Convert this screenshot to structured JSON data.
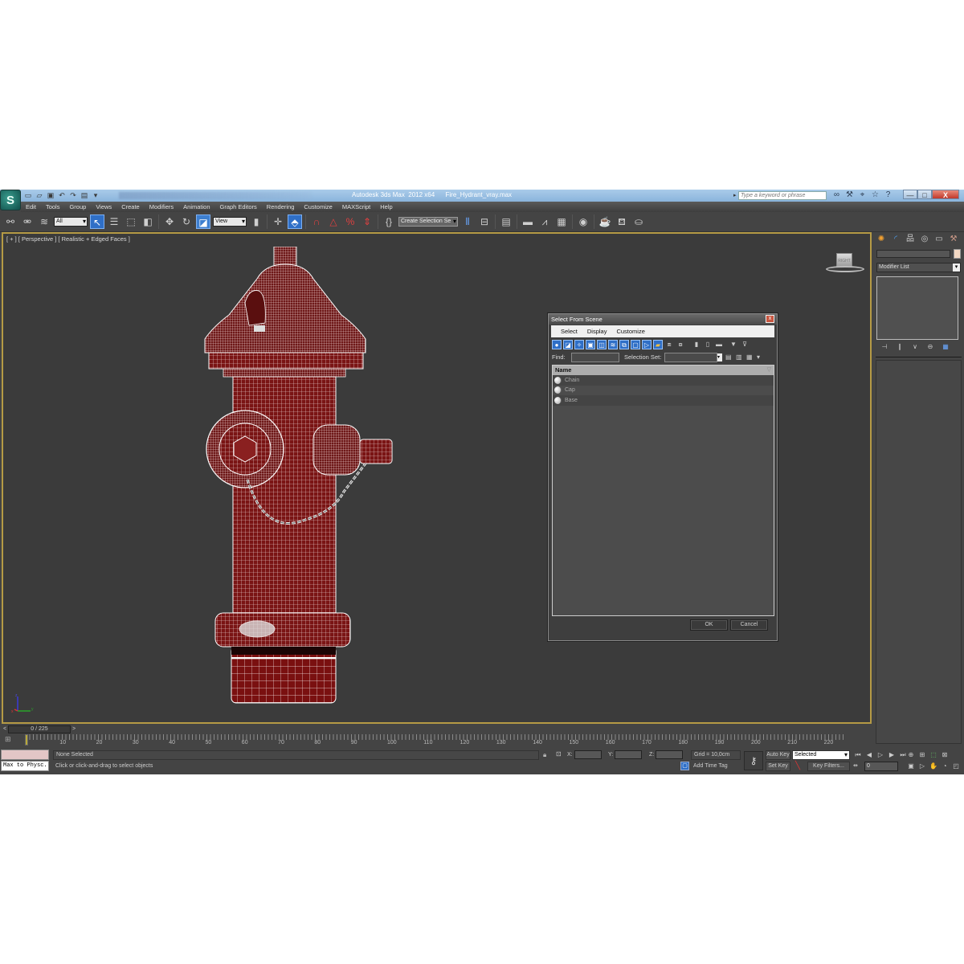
{
  "window": {
    "app_logo": "3ds Max logo",
    "title": "Autodesk 3ds Max  2012 x64      Fire_Hydrant_vray.max",
    "search_placeholder": "Type a keyword or phrase",
    "quick_access_icons": [
      "new-file-icon",
      "open-file-icon",
      "save-icon",
      "undo-icon",
      "redo-icon",
      "project-folder-icon",
      "dropdown-icon"
    ],
    "infocenter_icons": [
      "binoculars-icon",
      "wrench-icon",
      "satellite-icon",
      "star-icon",
      "help-icon"
    ],
    "controls": {
      "minimize": "—",
      "maximize": "□",
      "close": "X"
    }
  },
  "menu": [
    "Edit",
    "Tools",
    "Group",
    "Views",
    "Create",
    "Modifiers",
    "Animation",
    "Graph Editors",
    "Rendering",
    "Customize",
    "MAXScript",
    "Help"
  ],
  "toolbar": {
    "selection_filter": "All",
    "reference_coord": "View",
    "named_selection": "Create Selection Se",
    "snap_labels": [
      "3",
      "",
      "%",
      ""
    ]
  },
  "viewport": {
    "label": "[ + ] [ Perspective ] [ Realistic + Edged Faces ]",
    "viewcube_face": "RIGHT",
    "axis": {
      "x": "x",
      "y": "y",
      "z": "z"
    },
    "object": "Fire hydrant wireframe model"
  },
  "command_panel": {
    "tabs": [
      "create-tab",
      "modify-tab",
      "hierarchy-tab",
      "motion-tab",
      "display-tab",
      "utilities-tab"
    ],
    "object_name": "",
    "object_color": "#f3d8c3",
    "modifier_list": "Modifier List",
    "stack_tools": [
      "pin-stack-icon",
      "show-end-result-icon",
      "make-unique-icon",
      "remove-modifier-icon",
      "configure-sets-icon"
    ]
  },
  "dialog": {
    "title": "Select From Scene",
    "close": "x",
    "menu": [
      "Select",
      "Display",
      "Customize"
    ],
    "find_label": "Find:",
    "find_value": "",
    "selection_set_label": "Selection Set:",
    "selection_set_value": "",
    "column_header": "Name",
    "items": [
      "Chain",
      "Cap",
      "Base"
    ],
    "ok": "OK",
    "cancel": "Cancel"
  },
  "timeline": {
    "frame_display": "0 / 225",
    "current_frame": 0,
    "total_frames": 225,
    "ticks": [
      "10",
      "20",
      "30",
      "40",
      "50",
      "60",
      "70",
      "80",
      "90",
      "100",
      "110",
      "120",
      "130",
      "140",
      "150",
      "160",
      "170",
      "180",
      "190",
      "200",
      "210",
      "220"
    ],
    "prev": "<",
    "next": ">"
  },
  "status": {
    "listener": "Max to Physc.",
    "selection": "None Selected",
    "prompt": "Click or click-and-drag to select objects",
    "x_label": "X:",
    "y_label": "Y:",
    "z_label": "Z:",
    "x_value": "",
    "y_value": "",
    "z_value": "",
    "grid": "Grid = 10,0cm",
    "add_time_tag": "Add Time Tag",
    "auto_key": "Auto Key",
    "set_key": "Set Key",
    "key_mode": "Selected",
    "key_filters": "Key Filters...",
    "frame_value": "0"
  }
}
